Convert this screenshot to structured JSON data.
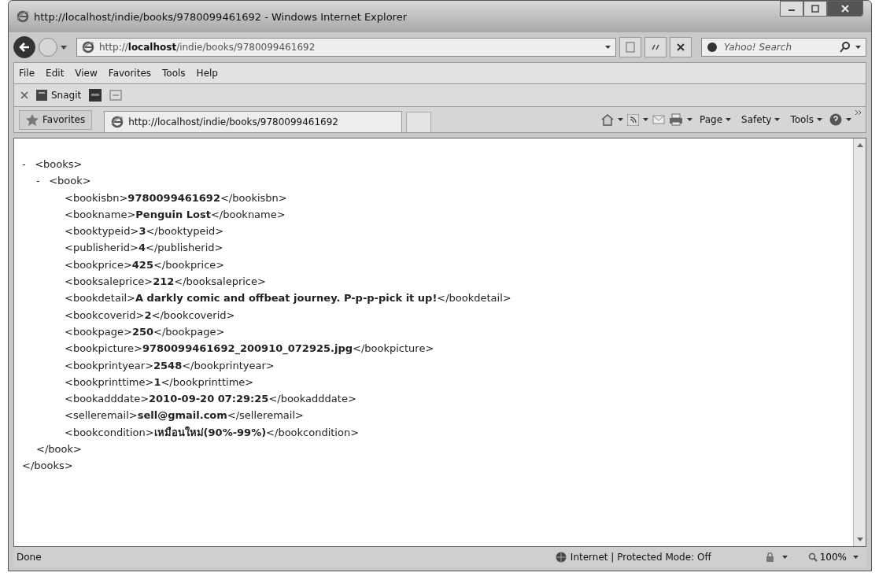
{
  "window": {
    "title": "http://localhost/indie/books/9780099461692 - Windows Internet Explorer"
  },
  "address_bar": {
    "url": "http://**localhost**/indie/books/9780099461692"
  },
  "search": {
    "placeholder": "Yahoo! Search"
  },
  "menu": [
    "File",
    "Edit",
    "View",
    "Favorites",
    "Tools",
    "Help"
  ],
  "toolbar": {
    "label": "Snagit"
  },
  "favorites_bar": {
    "label": "Favorites",
    "tabs": [
      {
        "title": "http://localhost/indie/books/9780099461692",
        "selected": true
      }
    ]
  },
  "command_bar": [
    "Page",
    "Safety",
    "Tools"
  ],
  "xml": [
    {
      "toggle": "-",
      "open_tag": "<books>",
      "close_tag": "</books>",
      "children": [
        {
          "toggle": "-",
          "open_tag": "<book>",
          "close_tag": "</book>",
          "children": [
            {
              "open_tag": "<bookisbn>",
              "value": "9780099461692",
              "close_tag": "</bookisbn>"
            },
            {
              "open_tag": "<bookname>",
              "value": "Penguin Lost",
              "close_tag": "</bookname>"
            },
            {
              "open_tag": "<booktypeid>",
              "value": "3",
              "close_tag": "</booktypeid>"
            },
            {
              "open_tag": "<publisherid>",
              "value": "4",
              "close_tag": "</publisherid>"
            },
            {
              "open_tag": "<bookprice>",
              "value": "425",
              "close_tag": "</bookprice>"
            },
            {
              "open_tag": "<booksaleprice>",
              "value": "212",
              "close_tag": "</booksaleprice>"
            },
            {
              "open_tag": "<bookdetail>",
              "value": "A darkly comic and offbeat journey. P-p-p-pick it up!",
              "close_tag": "</bookdetail>"
            },
            {
              "open_tag": "<bookcoverid>",
              "value": "2",
              "close_tag": "</bookcoverid>"
            },
            {
              "open_tag": "<bookpage>",
              "value": "250",
              "close_tag": "</bookpage>"
            },
            {
              "open_tag": "<bookpicture>",
              "value": "9780099461692_200910_072925.jpg",
              "close_tag": "</bookpicture>"
            },
            {
              "open_tag": "<bookprintyear>",
              "value": "2548",
              "close_tag": "</bookprintyear>"
            },
            {
              "open_tag": "<bookprinttime>",
              "value": "1",
              "close_tag": "</bookprinttime>"
            },
            {
              "open_tag": "<bookadddate>",
              "value": "2010-09-20 07:29:25",
              "close_tag": "</bookadddate>"
            },
            {
              "open_tag": "<selleremail>",
              "value": "sell@gmail.com",
              "close_tag": "</selleremail>"
            },
            {
              "open_tag": "<bookcondition>",
              "value": "เหมือนใหม่(90%-99%)",
              "close_tag": "</bookcondition>"
            }
          ]
        }
      ]
    }
  ],
  "status_bar": {
    "text": "Done",
    "zone": "Internet | Protected Mode: Off",
    "zoom": "100%"
  }
}
